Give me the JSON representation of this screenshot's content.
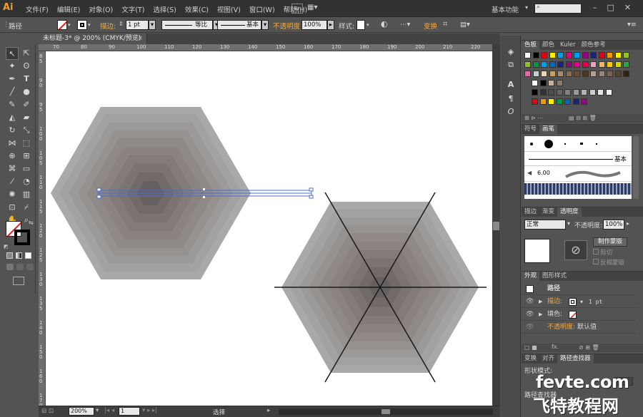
{
  "app": {
    "logo": "Ai",
    "workspace": "基本功能",
    "bridge_label": "Br"
  },
  "menu": [
    "文件(F)",
    "编辑(E)",
    "对象(O)",
    "文字(T)",
    "选择(S)",
    "效果(C)",
    "视图(V)",
    "窗口(W)",
    "帮助(H)"
  ],
  "control_bar": {
    "object_type": "路径",
    "stroke_label": "描边:",
    "stroke_value": "1 pt",
    "profile_label": "等比",
    "brush_label": "基本",
    "opacity_label": "不透明度",
    "opacity_value": "100%",
    "style_label": "样式:",
    "transform_label": "变换"
  },
  "document": {
    "tab_title": "未标题-3* @ 200% (CMYK/预览)"
  },
  "ruler": {
    "h_ticks": [
      "70",
      "80",
      "90",
      "100",
      "110",
      "120",
      "130",
      "140",
      "150",
      "160",
      "170",
      "180",
      "190",
      "200",
      "210",
      "220"
    ],
    "v_ticks": [
      "8 5",
      "9 0",
      "9 5",
      "1 0 0",
      "1 0 5",
      "1 1 0",
      "1 1 5",
      "1 2 0",
      "1 2 5",
      "1 3 0",
      "1 3 5",
      "1 4 0",
      "1 5 0",
      "1 6 0",
      "1 7 0"
    ]
  },
  "status": {
    "zoom": "200%",
    "page": "1",
    "tool": "选择"
  },
  "panels": {
    "swatches_tabs": [
      "色板",
      "颜色",
      "Kuler",
      "颜色参考"
    ],
    "brushes_tabs": [
      "符号",
      "画笔"
    ],
    "brush_basic": "基本",
    "brush_size": "6.00",
    "transparency_tabs": [
      "描边",
      "渐变",
      "透明度"
    ],
    "blend_mode": "正常",
    "opacity_label": "不透明度:",
    "opacity_value": "100%",
    "make_mask": "制作蒙版",
    "clip": "剪切",
    "invert_mask": "反相蒙版",
    "appearance_tabs": [
      "外观",
      "图形样式"
    ],
    "appearance_title": "路径",
    "stroke_row": "描边:",
    "stroke_val": "1 pt",
    "fill_row": "填色:",
    "opacity_row": "不透明度:",
    "opacity_row_val": "默认值",
    "fx_label": "fx.",
    "pathfinder_tabs": [
      "变换",
      "对齐",
      "路径查找器"
    ],
    "shape_modes": "形状模式:",
    "pathfinder_label": "路径查找器"
  },
  "watermark": {
    "site": "fevte.com",
    "name": "飞特教程网"
  },
  "colors": {
    "accent_orange": "#f3a93c",
    "selection_blue": "#4a6cd4"
  }
}
